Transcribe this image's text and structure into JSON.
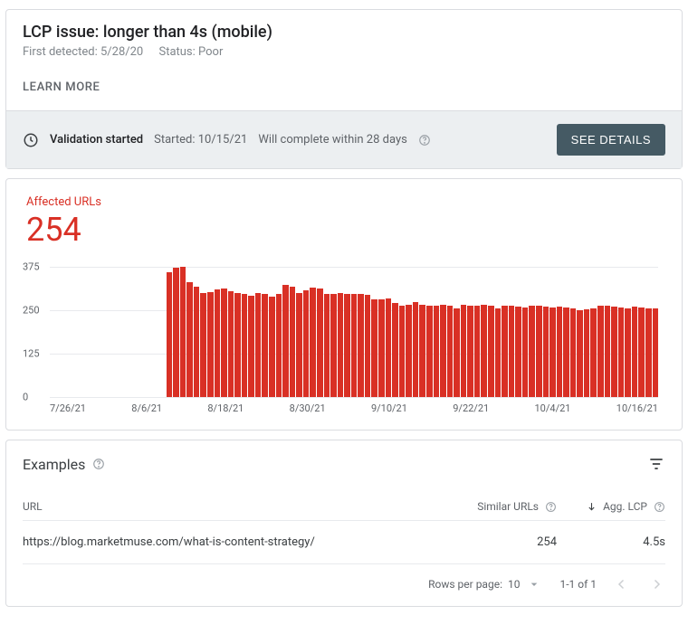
{
  "header": {
    "title": "LCP issue: longer than 4s (mobile)",
    "first_detected_label": "First detected: 5/28/20",
    "status_label": "Status: Poor",
    "learn_more": "LEARN MORE"
  },
  "status_bar": {
    "headline": "Validation started",
    "started": "Started: 10/15/21",
    "complete": "Will complete within 28 days",
    "button": "SEE DETAILS"
  },
  "affected": {
    "label": "Affected URLs",
    "count": "254"
  },
  "chart_data": {
    "type": "bar",
    "title": "Affected URLs",
    "ylabel": "",
    "xlabel": "",
    "ylim": [
      0,
      375
    ],
    "yticks": [
      0,
      125,
      250,
      375
    ],
    "xticks": [
      "7/26/21",
      "8/6/21",
      "8/18/21",
      "8/30/21",
      "9/10/21",
      "9/22/21",
      "10/4/21",
      "10/16/21"
    ],
    "start_date": "7/26/21",
    "end_date": "10/22/21",
    "n_days": 89,
    "first_nonzero_index": 17,
    "values": [
      0,
      0,
      0,
      0,
      0,
      0,
      0,
      0,
      0,
      0,
      0,
      0,
      0,
      0,
      0,
      0,
      0,
      360,
      372,
      376,
      330,
      318,
      300,
      302,
      310,
      312,
      305,
      300,
      296,
      292,
      300,
      296,
      290,
      298,
      322,
      318,
      300,
      308,
      316,
      312,
      298,
      296,
      300,
      298,
      296,
      296,
      294,
      280,
      282,
      284,
      270,
      264,
      266,
      274,
      266,
      264,
      262,
      266,
      264,
      254,
      266,
      264,
      262,
      266,
      264,
      256,
      264,
      262,
      260,
      258,
      264,
      262,
      260,
      258,
      260,
      258,
      256,
      250,
      252,
      254,
      262,
      264,
      260,
      258,
      256,
      260,
      258,
      256,
      254
    ]
  },
  "examples": {
    "title": "Examples",
    "columns": {
      "url": "URL",
      "similar": "Similar URLs",
      "agg": "Agg. LCP"
    },
    "rows": [
      {
        "url": "https://blog.marketmuse.com/what-is-content-strategy/",
        "similar": "254",
        "agg": "4.5s"
      }
    ],
    "pager": {
      "rows_label": "Rows per page:",
      "rows_value": "10",
      "range": "1-1 of 1"
    }
  }
}
